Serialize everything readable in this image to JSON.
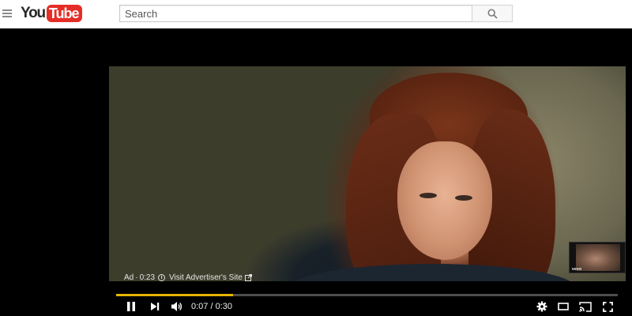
{
  "masthead": {
    "logo_you": "You",
    "logo_tube": "Tube",
    "search_placeholder": "Search"
  },
  "ad": {
    "label": "Ad",
    "countdown": "0:23",
    "advertiser_link": "Visit Advertiser's Site"
  },
  "thumbnail": {
    "badge": "vevo"
  },
  "player": {
    "current_time": "0:07",
    "duration": "0:30",
    "time_display": "0:07 / 0:30",
    "progress_fraction": 0.2333,
    "progress_color": "#e8b600"
  },
  "icons": {
    "menu": "hamburger-icon",
    "search": "search-icon",
    "pause": "pause-icon",
    "next": "next-icon",
    "volume": "volume-icon",
    "settings": "gear-icon",
    "theater": "theater-mode-icon",
    "cast": "cast-icon",
    "fullscreen": "fullscreen-icon"
  },
  "colors": {
    "brand_red": "#e52d27",
    "player_background": "#000000",
    "masthead_background": "#ffffff"
  }
}
